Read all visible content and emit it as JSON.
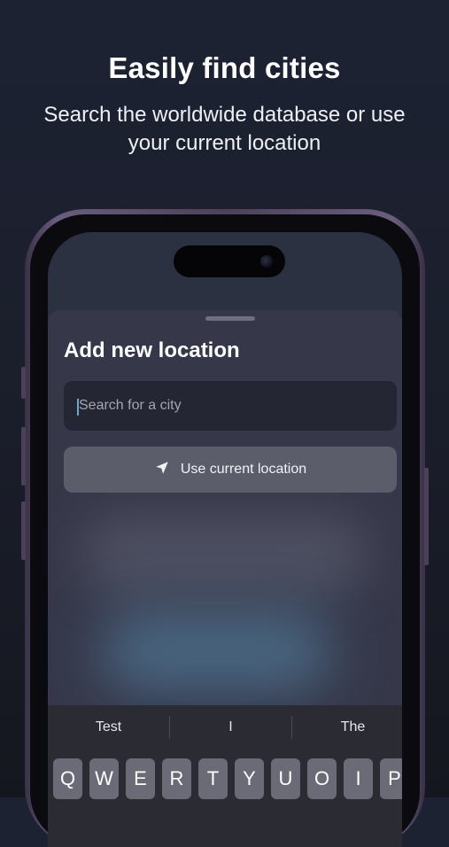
{
  "promo": {
    "headline": "Easily find cities",
    "subline": "Search the worldwide database or use your current location"
  },
  "sheet": {
    "title": "Add new location",
    "search": {
      "placeholder": "Search for a city",
      "value": ""
    },
    "use_location_label": "Use current location",
    "use_location_icon": "location-arrow-icon"
  },
  "keyboard": {
    "suggestions": [
      "Test",
      "I",
      "The"
    ],
    "row1": [
      "Q",
      "W",
      "E",
      "R",
      "T",
      "Y",
      "U",
      "O",
      "I",
      "P"
    ]
  }
}
